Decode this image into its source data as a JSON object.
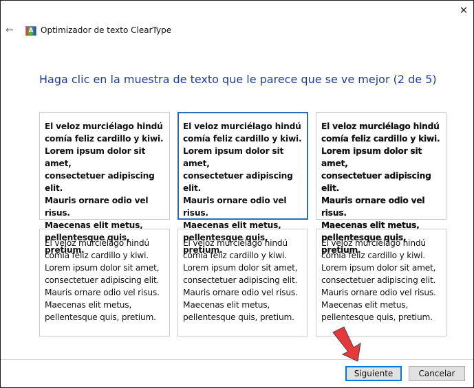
{
  "window": {
    "title": "Optimizador de texto ClearType",
    "close_icon": "close-icon",
    "back_icon": "back-arrow-icon"
  },
  "heading": "Haga clic en la muestra de texto que le parece que se ve mejor (2 de 5)",
  "samples": [
    {
      "text": "El veloz murciélago hindú\ncomía feliz cardillo y kiwi.\nLorem ipsum dolor sit amet,\nconsectetuer adipiscing elit.\nMauris ornare odio vel risus.\nMaecenas elit metus,\npellentesque quis, pretium.",
      "selected": false
    },
    {
      "text": "El veloz murciélago hindú\ncomía feliz cardillo y kiwi.\nLorem ipsum dolor sit amet,\nconsectetuer adipiscing elit.\nMauris ornare odio vel risus.\nMaecenas elit metus,\npellentesque quis, pretium.",
      "selected": true
    },
    {
      "text": "El veloz murciélago hindú\ncomía feliz cardillo y kiwi.\nLorem ipsum dolor sit amet,\nconsectetuer adipiscing elit.\nMauris ornare odio vel risus.\nMaecenas elit metus,\npellentesque quis, pretium.",
      "selected": false
    },
    {
      "text": "El veloz murciélago hindú\ncomía feliz cardillo y kiwi.\nLorem ipsum dolor sit amet,\nconsectetuer adipiscing elit.\nMauris ornare odio vel risus.\nMaecenas elit metus,\npellentesque quis, pretium.",
      "selected": false
    },
    {
      "text": "El veloz murciélago hindú\ncomía feliz cardillo y kiwi.\nLorem ipsum dolor sit amet,\nconsectetuer adipiscing elit.\nMauris ornare odio vel risus.\nMaecenas elit metus,\npellentesque quis, pretium.",
      "selected": false
    },
    {
      "text": "El veloz murciélago hindú\ncomía feliz cardillo y kiwi.\nLorem ipsum dolor sit amet,\nconsectetuer adipiscing elit.\nMauris ornare odio vel risus.\nMaecenas elit metus,\npellentesque quis, pretium.",
      "selected": false
    }
  ],
  "buttons": {
    "next": "Siguiente",
    "cancel": "Cancelar"
  },
  "colors": {
    "heading": "#1e3c9a",
    "selection": "#2e6bb3",
    "annotation_arrow": "#e8383b"
  }
}
